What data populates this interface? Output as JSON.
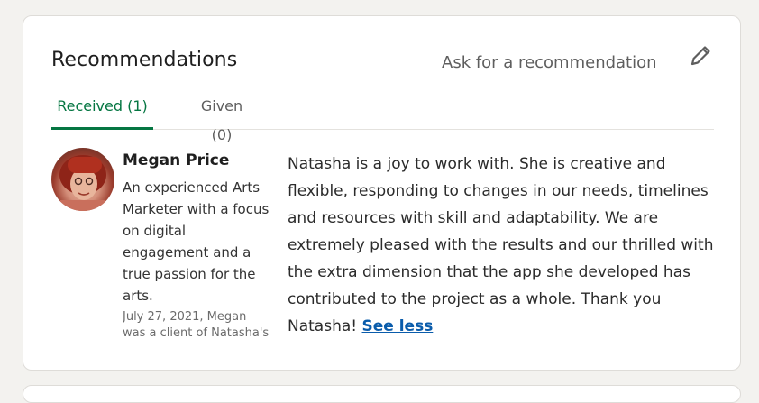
{
  "header": {
    "title": "Recommendations",
    "ask_label": "Ask for a recommendation",
    "edit_icon": "pencil-icon"
  },
  "tabs": [
    {
      "label": "Received (1)",
      "active": true
    },
    {
      "label": "Given (0)",
      "active": false
    }
  ],
  "recommendation": {
    "name": "Megan Price",
    "headline": "An experienced Arts Marketer with a focus on digital engagement and a true passion for the arts.",
    "meta_line1": "July 27, 2021, Megan",
    "meta_line2": "was a client of Natasha's",
    "text": "Natasha is a joy to work with. She is creative and flexible, responding to changes in our needs, timelines and resources with skill and adaptability. We are extremely pleased with the results and our thrilled with the extra dimension that the app she developed has contributed to the project as a whole. Thank you Natasha!",
    "see_less_label": "See less"
  },
  "colors": {
    "accent_green": "#057642",
    "link_blue": "#0a5cab"
  }
}
